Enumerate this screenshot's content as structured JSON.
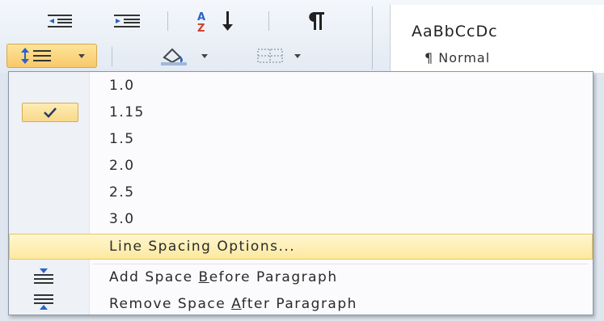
{
  "ribbon": {
    "styles_gallery": {
      "sample_text": "AaBbCcDc",
      "style_name": "¶ Normal"
    },
    "buttons": [
      {
        "name": "decrease-indent-icon"
      },
      {
        "name": "increase-indent-icon"
      },
      {
        "name": "sort-icon"
      },
      {
        "name": "show-formatting-marks-icon"
      },
      {
        "name": "line-spacing-icon"
      },
      {
        "name": "shading-icon"
      },
      {
        "name": "borders-icon"
      }
    ]
  },
  "menu": {
    "spacing_options": [
      {
        "label": "1.0",
        "checked": false
      },
      {
        "label": "1.15",
        "checked": true
      },
      {
        "label": "1.5",
        "checked": false
      },
      {
        "label": "2.0",
        "checked": false
      },
      {
        "label": "2.5",
        "checked": false
      },
      {
        "label": "3.0",
        "checked": false
      }
    ],
    "line_spacing_options": "Line Spacing Options...",
    "add_space_before": {
      "pre": "Add Space ",
      "key": "B",
      "post": "efore Paragraph"
    },
    "remove_space_after": {
      "pre": "Remove Space ",
      "key": "A",
      "post": "fter Paragraph"
    }
  },
  "colors": {
    "highlight": "#fce9a0",
    "highlight_border": "#e7c76a",
    "menu_background": "#fbfbfd",
    "ribbon_background": "#e3eaf3"
  }
}
